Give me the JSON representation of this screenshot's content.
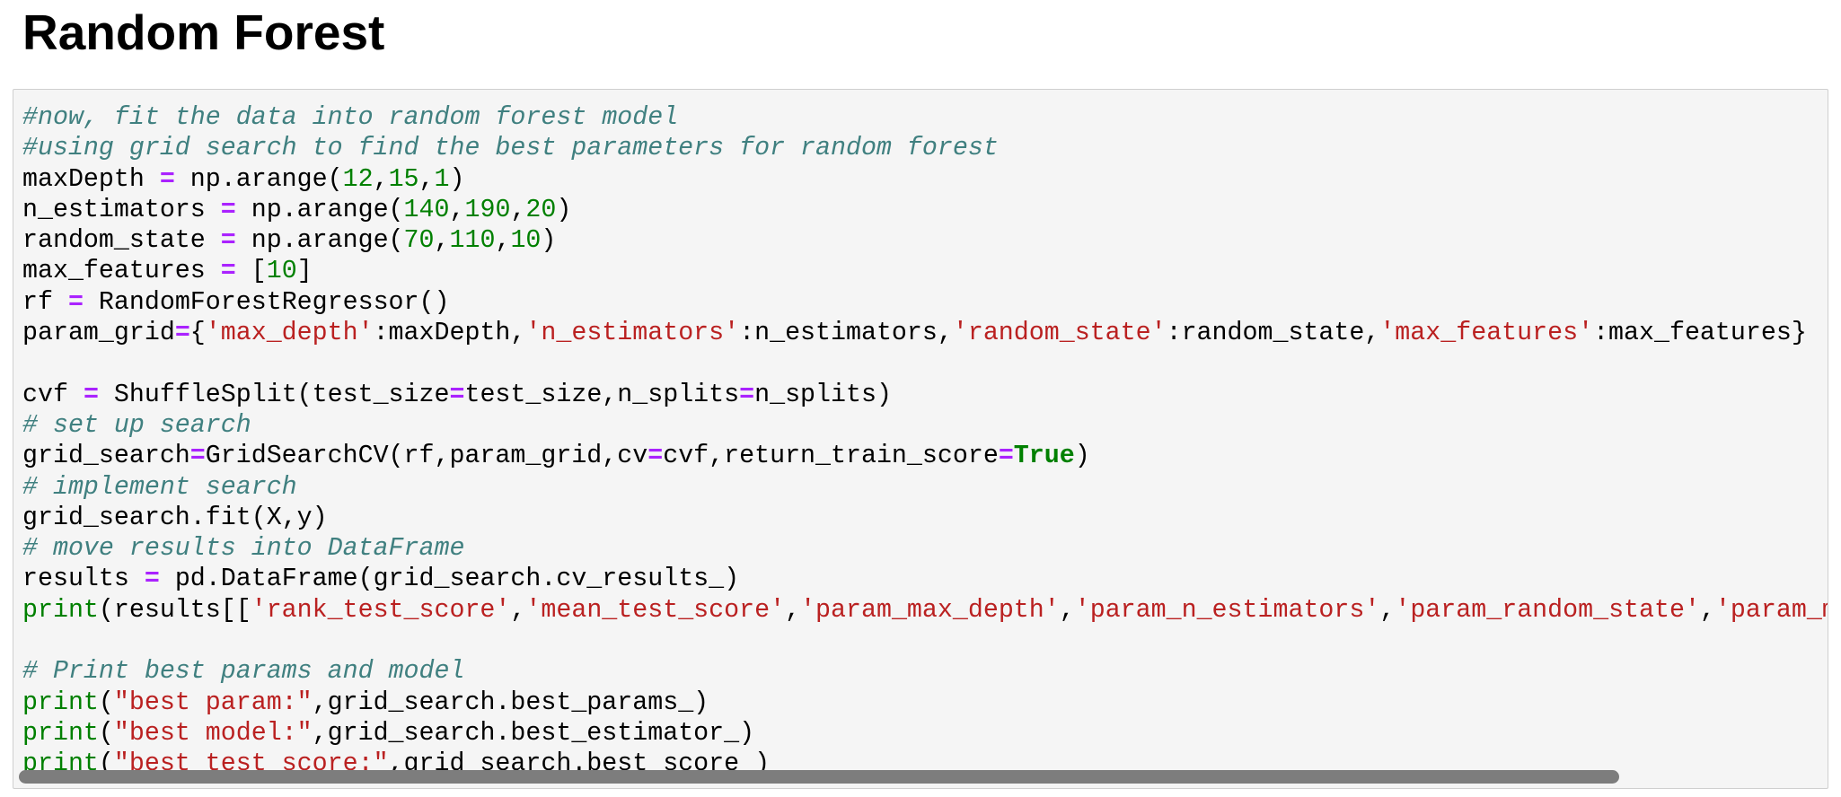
{
  "heading": "Random Forest",
  "code_lines": [
    [
      {
        "t": "c",
        "v": "#now, fit the data into random forest model"
      }
    ],
    [
      {
        "t": "c",
        "v": "#using grid search to find the best parameters for random forest"
      }
    ],
    [
      {
        "t": "n",
        "v": "maxDepth "
      },
      {
        "t": "o",
        "v": "="
      },
      {
        "t": "n",
        "v": " np.arange("
      },
      {
        "t": "m",
        "v": "12"
      },
      {
        "t": "p",
        "v": ","
      },
      {
        "t": "m",
        "v": "15"
      },
      {
        "t": "p",
        "v": ","
      },
      {
        "t": "m",
        "v": "1"
      },
      {
        "t": "p",
        "v": ")"
      }
    ],
    [
      {
        "t": "n",
        "v": "n_estimators "
      },
      {
        "t": "o",
        "v": "="
      },
      {
        "t": "n",
        "v": " np.arange("
      },
      {
        "t": "m",
        "v": "140"
      },
      {
        "t": "p",
        "v": ","
      },
      {
        "t": "m",
        "v": "190"
      },
      {
        "t": "p",
        "v": ","
      },
      {
        "t": "m",
        "v": "20"
      },
      {
        "t": "p",
        "v": ")"
      }
    ],
    [
      {
        "t": "n",
        "v": "random_state "
      },
      {
        "t": "o",
        "v": "="
      },
      {
        "t": "n",
        "v": " np.arange("
      },
      {
        "t": "m",
        "v": "70"
      },
      {
        "t": "p",
        "v": ","
      },
      {
        "t": "m",
        "v": "110"
      },
      {
        "t": "p",
        "v": ","
      },
      {
        "t": "m",
        "v": "10"
      },
      {
        "t": "p",
        "v": ")"
      }
    ],
    [
      {
        "t": "n",
        "v": "max_features "
      },
      {
        "t": "o",
        "v": "="
      },
      {
        "t": "n",
        "v": " ["
      },
      {
        "t": "m",
        "v": "10"
      },
      {
        "t": "p",
        "v": "]"
      }
    ],
    [
      {
        "t": "n",
        "v": "rf "
      },
      {
        "t": "o",
        "v": "="
      },
      {
        "t": "n",
        "v": " RandomForestRegressor()"
      }
    ],
    [
      {
        "t": "n",
        "v": "param_grid"
      },
      {
        "t": "o",
        "v": "="
      },
      {
        "t": "p",
        "v": "{"
      },
      {
        "t": "s",
        "v": "'max_depth'"
      },
      {
        "t": "p",
        "v": ":maxDepth,"
      },
      {
        "t": "s",
        "v": "'n_estimators'"
      },
      {
        "t": "p",
        "v": ":n_estimators,"
      },
      {
        "t": "s",
        "v": "'random_state'"
      },
      {
        "t": "p",
        "v": ":random_state,"
      },
      {
        "t": "s",
        "v": "'max_features'"
      },
      {
        "t": "p",
        "v": ":max_features}"
      }
    ],
    [],
    [
      {
        "t": "n",
        "v": "cvf "
      },
      {
        "t": "o",
        "v": "="
      },
      {
        "t": "n",
        "v": " ShuffleSplit(test_size"
      },
      {
        "t": "o",
        "v": "="
      },
      {
        "t": "n",
        "v": "test_size,n_splits"
      },
      {
        "t": "o",
        "v": "="
      },
      {
        "t": "n",
        "v": "n_splits)"
      }
    ],
    [
      {
        "t": "c",
        "v": "# set up search"
      }
    ],
    [
      {
        "t": "n",
        "v": "grid_search"
      },
      {
        "t": "o",
        "v": "="
      },
      {
        "t": "n",
        "v": "GridSearchCV(rf,param_grid,cv"
      },
      {
        "t": "o",
        "v": "="
      },
      {
        "t": "n",
        "v": "cvf,return_train_score"
      },
      {
        "t": "o",
        "v": "="
      },
      {
        "t": "k",
        "v": "True"
      },
      {
        "t": "p",
        "v": ")"
      }
    ],
    [
      {
        "t": "c",
        "v": "# implement search"
      }
    ],
    [
      {
        "t": "n",
        "v": "grid_search.fit(X,y)"
      }
    ],
    [
      {
        "t": "c",
        "v": "# move results into DataFrame"
      }
    ],
    [
      {
        "t": "n",
        "v": "results "
      },
      {
        "t": "o",
        "v": "="
      },
      {
        "t": "n",
        "v": " pd.DataFrame(grid_search.cv_results_)"
      }
    ],
    [
      {
        "t": "b",
        "v": "print"
      },
      {
        "t": "p",
        "v": "(results[["
      },
      {
        "t": "s",
        "v": "'rank_test_score'"
      },
      {
        "t": "p",
        "v": ","
      },
      {
        "t": "s",
        "v": "'mean_test_score'"
      },
      {
        "t": "p",
        "v": ","
      },
      {
        "t": "s",
        "v": "'param_max_depth'"
      },
      {
        "t": "p",
        "v": ","
      },
      {
        "t": "s",
        "v": "'param_n_estimators'"
      },
      {
        "t": "p",
        "v": ","
      },
      {
        "t": "s",
        "v": "'param_random_state'"
      },
      {
        "t": "p",
        "v": ","
      },
      {
        "t": "s",
        "v": "'param_m"
      }
    ],
    [],
    [
      {
        "t": "c",
        "v": "# Print best params and model"
      }
    ],
    [
      {
        "t": "b",
        "v": "print"
      },
      {
        "t": "p",
        "v": "("
      },
      {
        "t": "s",
        "v": "\"best param:\""
      },
      {
        "t": "p",
        "v": ",grid_search.best_params_)"
      }
    ],
    [
      {
        "t": "b",
        "v": "print"
      },
      {
        "t": "p",
        "v": "("
      },
      {
        "t": "s",
        "v": "\"best model:\""
      },
      {
        "t": "p",
        "v": ",grid_search.best_estimator_)"
      }
    ],
    [
      {
        "t": "b",
        "v": "print"
      },
      {
        "t": "p",
        "v": "("
      },
      {
        "t": "s",
        "v": "\"best test score:\""
      },
      {
        "t": "p",
        "v": ",grid_search.best_score_)"
      }
    ]
  ],
  "colors": {
    "comment": "#408080",
    "operator": "#aa22ff",
    "number": "#008000",
    "string": "#ba2121",
    "keyword": "#008000",
    "builtin": "#008000",
    "cell_background": "#f5f5f5",
    "scrollbar": "#7d7d7d"
  }
}
